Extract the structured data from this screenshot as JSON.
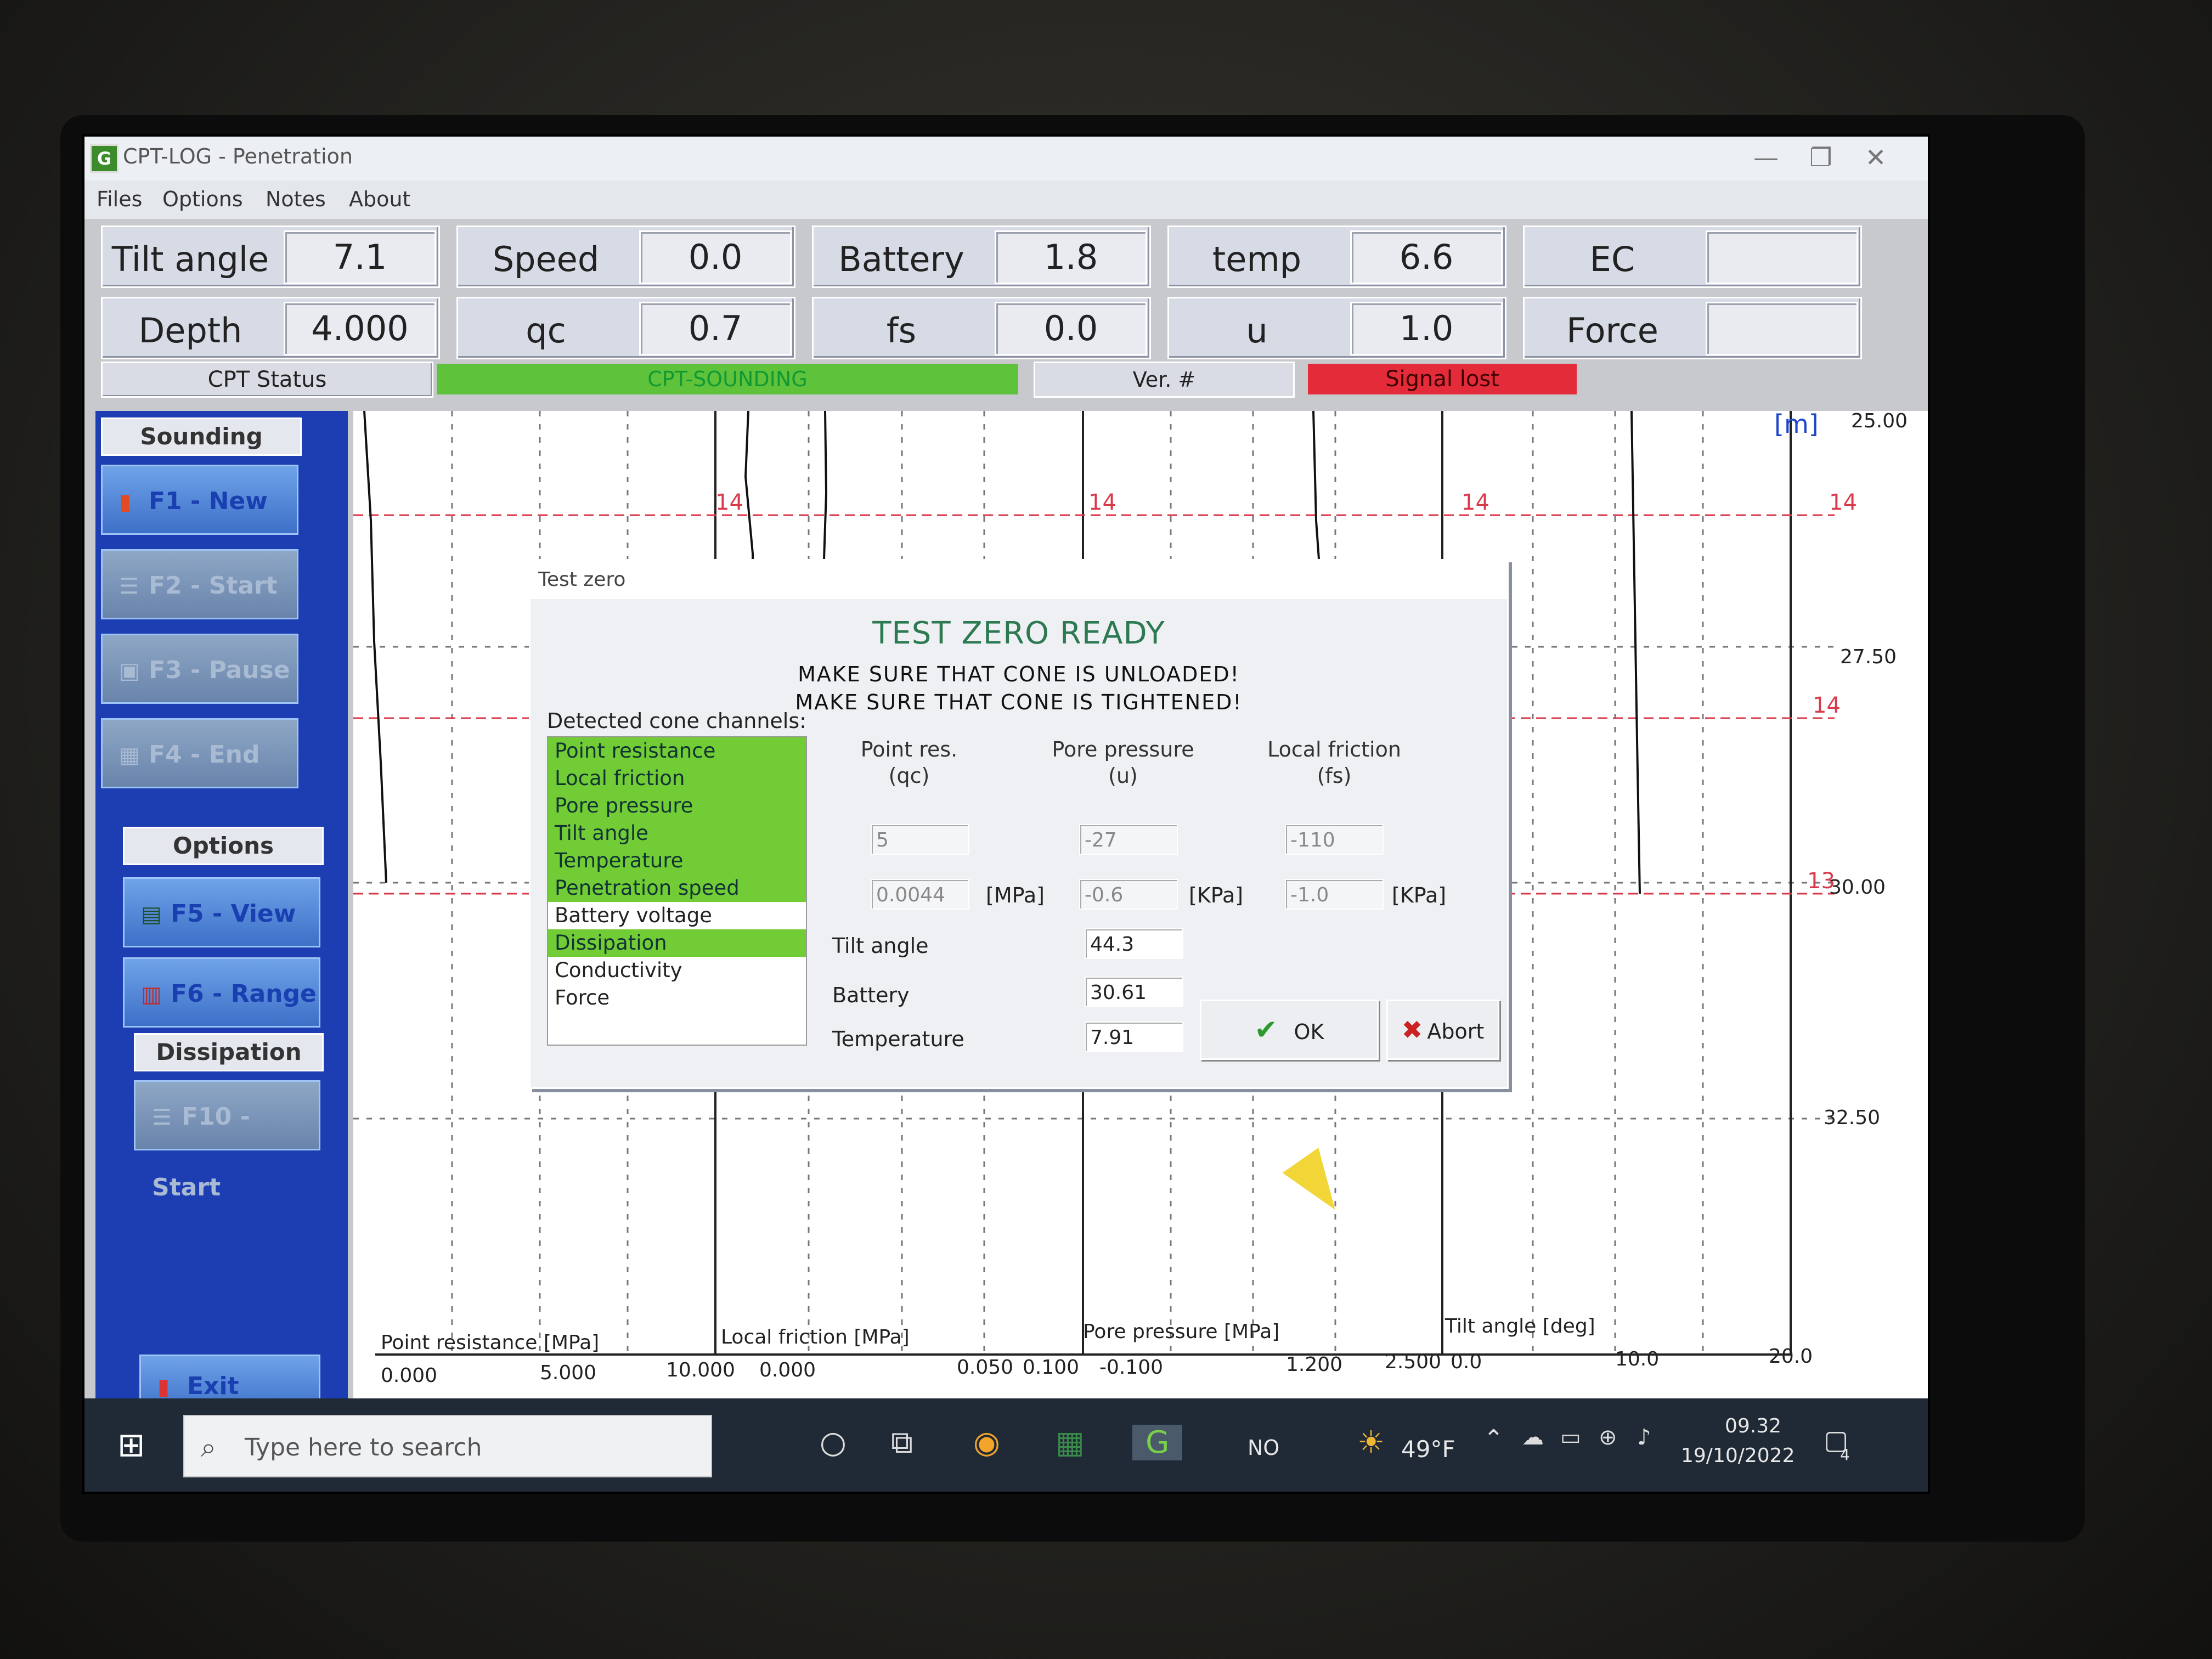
{
  "window": {
    "title": "CPT-LOG - Penetration",
    "app_icon": "G",
    "controls": [
      "—",
      "❐",
      "✕"
    ]
  },
  "menu": [
    "Files",
    "Options",
    "Notes",
    "About"
  ],
  "readouts": {
    "row1": [
      {
        "label": "Tilt angle",
        "value": "7.1"
      },
      {
        "label": "Speed",
        "value": "0.0"
      },
      {
        "label": "Battery",
        "value": "1.8"
      },
      {
        "label": "temp",
        "value": "6.6"
      },
      {
        "label": "EC",
        "value": ""
      }
    ],
    "row2": [
      {
        "label": "Depth",
        "value": "4.000"
      },
      {
        "label": "qc",
        "value": "0.7"
      },
      {
        "label": "fs",
        "value": "0.0"
      },
      {
        "label": "u",
        "value": "1.0"
      },
      {
        "label": "Force",
        "value": ""
      }
    ]
  },
  "status": {
    "label": "CPT Status",
    "state": "CPT-SOUNDING",
    "version_label": "Ver. #",
    "signal": "Signal lost",
    "state_color": "#5ec23a",
    "signal_color": "#e32b3a"
  },
  "sidebar": {
    "sounding_header": "Sounding",
    "f1": "F1 - New",
    "f2": "F2 - Start",
    "f3": "F3 - Pause",
    "f4": "F4 - End",
    "options_header": "Options",
    "f5": "F5 - View",
    "f6": "F6 - Range",
    "dissipation_header": "Dissipation",
    "f10": "F10 - Start",
    "exit": "Exit"
  },
  "plot": {
    "depth_unit": "[m]",
    "depth_ticks": [
      "25.00",
      "27.50",
      "30.00",
      "32.50"
    ],
    "marker_label": "14",
    "marker_label_2": "13",
    "axes": [
      {
        "label": "Point resistance [MPa]",
        "ticks": [
          "0.000",
          "5.000",
          "10.000"
        ]
      },
      {
        "label": "Local friction [MPa]",
        "ticks": [
          "0.000",
          "0.050",
          "0.100"
        ]
      },
      {
        "label": "Pore pressure [MPa]",
        "ticks": [
          "-0.100",
          "1.200",
          "2.500"
        ]
      },
      {
        "label": "Tilt angle [deg]",
        "ticks": [
          "0.0",
          "10.0",
          "20.0"
        ]
      }
    ]
  },
  "dialog": {
    "title": "Test zero",
    "heading": "TEST ZERO READY",
    "warn1": "MAKE SURE THAT CONE IS UNLOADED!",
    "warn2": "MAKE SURE THAT CONE IS TIGHTENED!",
    "channels_label": "Detected cone channels:",
    "channels": [
      {
        "name": "Point resistance",
        "detected": true
      },
      {
        "name": "Local friction",
        "detected": true
      },
      {
        "name": "Pore pressure",
        "detected": true
      },
      {
        "name": "Tilt angle",
        "detected": true
      },
      {
        "name": "Temperature",
        "detected": true
      },
      {
        "name": "Penetration speed",
        "detected": true
      },
      {
        "name": "Battery voltage",
        "detected": false
      },
      {
        "name": "Dissipation",
        "detected": true
      },
      {
        "name": "Conductivity",
        "detected": false
      },
      {
        "name": "Force",
        "detected": false
      }
    ],
    "col_qc": {
      "name": "Point res.",
      "sym": "(qc)",
      "raw": "5",
      "value": "0.0044",
      "unit": "[MPa]"
    },
    "col_u": {
      "name": "Pore pressure",
      "sym": "(u)",
      "raw": "-27",
      "value": "-0.6",
      "unit": "[KPa]"
    },
    "col_fs": {
      "name": "Local friction",
      "sym": "(fs)",
      "raw": "-110",
      "value": "-1.0",
      "unit": "[KPa]"
    },
    "tilt_label": "Tilt angle",
    "tilt_value": "44.3",
    "battery_label": "Battery",
    "battery_value": "30.61",
    "temp_label": "Temperature",
    "temp_value": "7.91",
    "ok": "OK",
    "abort": "Abort"
  },
  "taskbar": {
    "search_placeholder": "Type here to search",
    "lang": "NO",
    "weather": "49°F",
    "time": "09.32",
    "date": "19/10/2022",
    "notifications": "4"
  }
}
